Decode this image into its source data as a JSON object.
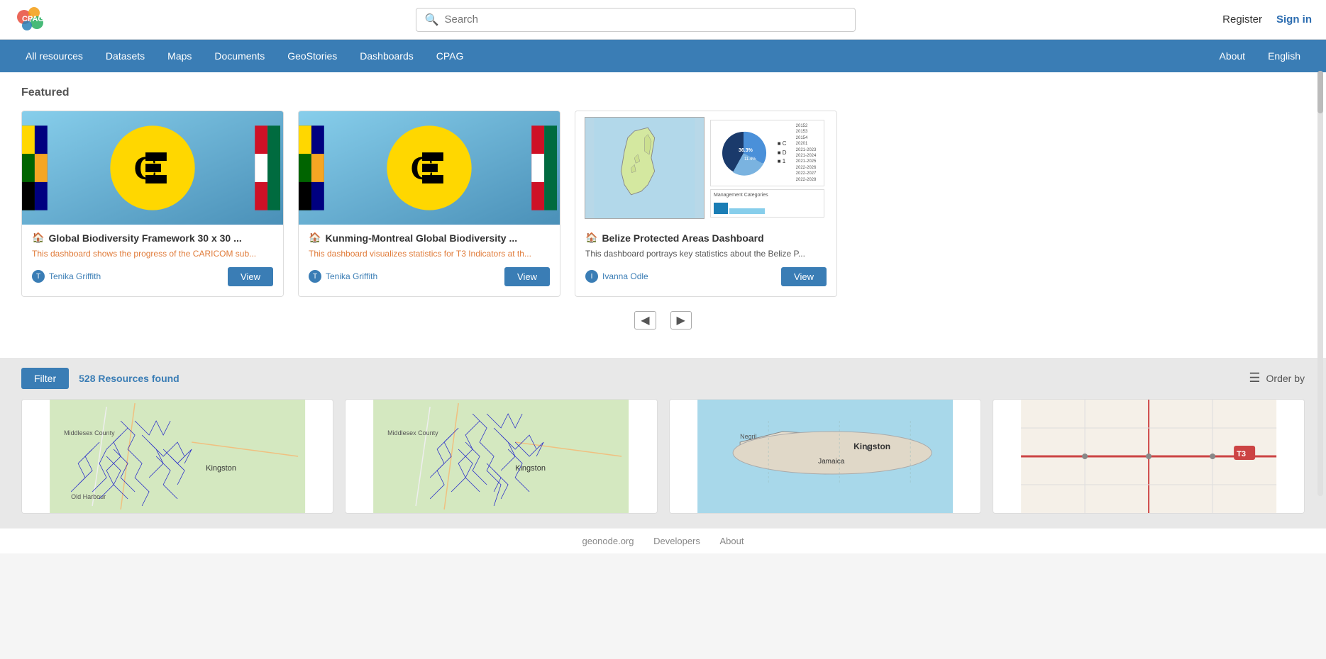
{
  "site": {
    "title": "CPAG"
  },
  "header": {
    "search_placeholder": "Search",
    "register_label": "Register",
    "signin_label": "Sign in"
  },
  "nav": {
    "items": [
      {
        "label": "All resources",
        "href": "#"
      },
      {
        "label": "Datasets",
        "href": "#"
      },
      {
        "label": "Maps",
        "href": "#"
      },
      {
        "label": "Documents",
        "href": "#"
      },
      {
        "label": "GeoStories",
        "href": "#"
      },
      {
        "label": "Dashboards",
        "href": "#"
      },
      {
        "label": "CPAG",
        "href": "#"
      }
    ],
    "right_items": [
      {
        "label": "About",
        "href": "#"
      },
      {
        "label": "English",
        "href": "#"
      }
    ]
  },
  "featured": {
    "section_title": "Featured",
    "cards": [
      {
        "title": "Global Biodiversity Framework 30 x 30 ...",
        "description": "This dashboard shows the progress of the CARICOM sub...",
        "author": "Tenika Griffith",
        "type": "dashboard",
        "type_icon": "🏠",
        "view_label": "View"
      },
      {
        "title": "Kunming-Montreal Global Biodiversity ...",
        "description": "This dashboard visualizes statistics for T3 Indicators at th...",
        "author": "Tenika Griffith",
        "type": "dashboard",
        "type_icon": "🏠",
        "view_label": "View"
      },
      {
        "title": "Belize Protected Areas Dashboard",
        "description": "This dashboard portrays key statistics about the Belize P...",
        "author": "Ivanna Odle",
        "type": "dashboard",
        "type_icon": "🏠",
        "view_label": "View",
        "desc_neutral": true
      }
    ]
  },
  "filter_bar": {
    "filter_label": "Filter",
    "count_text": "528 Resources found",
    "count_number": "528",
    "order_by_label": "Order by"
  },
  "resource_grid": {
    "cards": [
      {
        "type": "map",
        "color1": "#c8e6c9",
        "color2": "#4169e1"
      },
      {
        "type": "map",
        "color1": "#c8e6c9",
        "color2": "#4169e1"
      },
      {
        "type": "map",
        "color1": "#b2d8e8",
        "color2": "#1a1a2e"
      },
      {
        "type": "map",
        "color1": "#f0e8d0",
        "color2": "#cc4444"
      }
    ]
  },
  "footer": {
    "links": [
      {
        "label": "geonode.org",
        "href": "#"
      },
      {
        "label": "Developers",
        "href": "#"
      },
      {
        "label": "About",
        "href": "#"
      }
    ]
  }
}
